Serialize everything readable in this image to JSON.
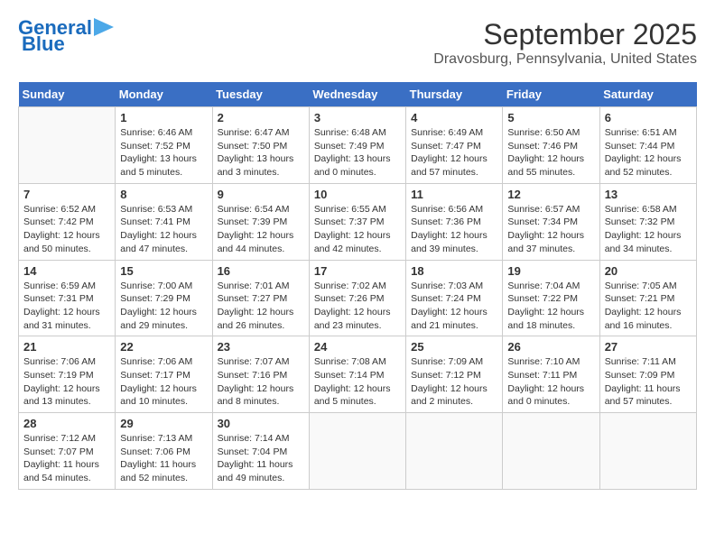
{
  "logo": {
    "line1": "General",
    "line2": "Blue"
  },
  "title": "September 2025",
  "subtitle": "Dravosburg, Pennsylvania, United States",
  "days": [
    "Sunday",
    "Monday",
    "Tuesday",
    "Wednesday",
    "Thursday",
    "Friday",
    "Saturday"
  ],
  "weeks": [
    [
      {
        "num": "",
        "sunrise": "",
        "sunset": "",
        "daylight": ""
      },
      {
        "num": "1",
        "sunrise": "Sunrise: 6:46 AM",
        "sunset": "Sunset: 7:52 PM",
        "daylight": "Daylight: 13 hours and 5 minutes."
      },
      {
        "num": "2",
        "sunrise": "Sunrise: 6:47 AM",
        "sunset": "Sunset: 7:50 PM",
        "daylight": "Daylight: 13 hours and 3 minutes."
      },
      {
        "num": "3",
        "sunrise": "Sunrise: 6:48 AM",
        "sunset": "Sunset: 7:49 PM",
        "daylight": "Daylight: 13 hours and 0 minutes."
      },
      {
        "num": "4",
        "sunrise": "Sunrise: 6:49 AM",
        "sunset": "Sunset: 7:47 PM",
        "daylight": "Daylight: 12 hours and 57 minutes."
      },
      {
        "num": "5",
        "sunrise": "Sunrise: 6:50 AM",
        "sunset": "Sunset: 7:46 PM",
        "daylight": "Daylight: 12 hours and 55 minutes."
      },
      {
        "num": "6",
        "sunrise": "Sunrise: 6:51 AM",
        "sunset": "Sunset: 7:44 PM",
        "daylight": "Daylight: 12 hours and 52 minutes."
      }
    ],
    [
      {
        "num": "7",
        "sunrise": "Sunrise: 6:52 AM",
        "sunset": "Sunset: 7:42 PM",
        "daylight": "Daylight: 12 hours and 50 minutes."
      },
      {
        "num": "8",
        "sunrise": "Sunrise: 6:53 AM",
        "sunset": "Sunset: 7:41 PM",
        "daylight": "Daylight: 12 hours and 47 minutes."
      },
      {
        "num": "9",
        "sunrise": "Sunrise: 6:54 AM",
        "sunset": "Sunset: 7:39 PM",
        "daylight": "Daylight: 12 hours and 44 minutes."
      },
      {
        "num": "10",
        "sunrise": "Sunrise: 6:55 AM",
        "sunset": "Sunset: 7:37 PM",
        "daylight": "Daylight: 12 hours and 42 minutes."
      },
      {
        "num": "11",
        "sunrise": "Sunrise: 6:56 AM",
        "sunset": "Sunset: 7:36 PM",
        "daylight": "Daylight: 12 hours and 39 minutes."
      },
      {
        "num": "12",
        "sunrise": "Sunrise: 6:57 AM",
        "sunset": "Sunset: 7:34 PM",
        "daylight": "Daylight: 12 hours and 37 minutes."
      },
      {
        "num": "13",
        "sunrise": "Sunrise: 6:58 AM",
        "sunset": "Sunset: 7:32 PM",
        "daylight": "Daylight: 12 hours and 34 minutes."
      }
    ],
    [
      {
        "num": "14",
        "sunrise": "Sunrise: 6:59 AM",
        "sunset": "Sunset: 7:31 PM",
        "daylight": "Daylight: 12 hours and 31 minutes."
      },
      {
        "num": "15",
        "sunrise": "Sunrise: 7:00 AM",
        "sunset": "Sunset: 7:29 PM",
        "daylight": "Daylight: 12 hours and 29 minutes."
      },
      {
        "num": "16",
        "sunrise": "Sunrise: 7:01 AM",
        "sunset": "Sunset: 7:27 PM",
        "daylight": "Daylight: 12 hours and 26 minutes."
      },
      {
        "num": "17",
        "sunrise": "Sunrise: 7:02 AM",
        "sunset": "Sunset: 7:26 PM",
        "daylight": "Daylight: 12 hours and 23 minutes."
      },
      {
        "num": "18",
        "sunrise": "Sunrise: 7:03 AM",
        "sunset": "Sunset: 7:24 PM",
        "daylight": "Daylight: 12 hours and 21 minutes."
      },
      {
        "num": "19",
        "sunrise": "Sunrise: 7:04 AM",
        "sunset": "Sunset: 7:22 PM",
        "daylight": "Daylight: 12 hours and 18 minutes."
      },
      {
        "num": "20",
        "sunrise": "Sunrise: 7:05 AM",
        "sunset": "Sunset: 7:21 PM",
        "daylight": "Daylight: 12 hours and 16 minutes."
      }
    ],
    [
      {
        "num": "21",
        "sunrise": "Sunrise: 7:06 AM",
        "sunset": "Sunset: 7:19 PM",
        "daylight": "Daylight: 12 hours and 13 minutes."
      },
      {
        "num": "22",
        "sunrise": "Sunrise: 7:06 AM",
        "sunset": "Sunset: 7:17 PM",
        "daylight": "Daylight: 12 hours and 10 minutes."
      },
      {
        "num": "23",
        "sunrise": "Sunrise: 7:07 AM",
        "sunset": "Sunset: 7:16 PM",
        "daylight": "Daylight: 12 hours and 8 minutes."
      },
      {
        "num": "24",
        "sunrise": "Sunrise: 7:08 AM",
        "sunset": "Sunset: 7:14 PM",
        "daylight": "Daylight: 12 hours and 5 minutes."
      },
      {
        "num": "25",
        "sunrise": "Sunrise: 7:09 AM",
        "sunset": "Sunset: 7:12 PM",
        "daylight": "Daylight: 12 hours and 2 minutes."
      },
      {
        "num": "26",
        "sunrise": "Sunrise: 7:10 AM",
        "sunset": "Sunset: 7:11 PM",
        "daylight": "Daylight: 12 hours and 0 minutes."
      },
      {
        "num": "27",
        "sunrise": "Sunrise: 7:11 AM",
        "sunset": "Sunset: 7:09 PM",
        "daylight": "Daylight: 11 hours and 57 minutes."
      }
    ],
    [
      {
        "num": "28",
        "sunrise": "Sunrise: 7:12 AM",
        "sunset": "Sunset: 7:07 PM",
        "daylight": "Daylight: 11 hours and 54 minutes."
      },
      {
        "num": "29",
        "sunrise": "Sunrise: 7:13 AM",
        "sunset": "Sunset: 7:06 PM",
        "daylight": "Daylight: 11 hours and 52 minutes."
      },
      {
        "num": "30",
        "sunrise": "Sunrise: 7:14 AM",
        "sunset": "Sunset: 7:04 PM",
        "daylight": "Daylight: 11 hours and 49 minutes."
      },
      {
        "num": "",
        "sunrise": "",
        "sunset": "",
        "daylight": ""
      },
      {
        "num": "",
        "sunrise": "",
        "sunset": "",
        "daylight": ""
      },
      {
        "num": "",
        "sunrise": "",
        "sunset": "",
        "daylight": ""
      },
      {
        "num": "",
        "sunrise": "",
        "sunset": "",
        "daylight": ""
      }
    ]
  ]
}
